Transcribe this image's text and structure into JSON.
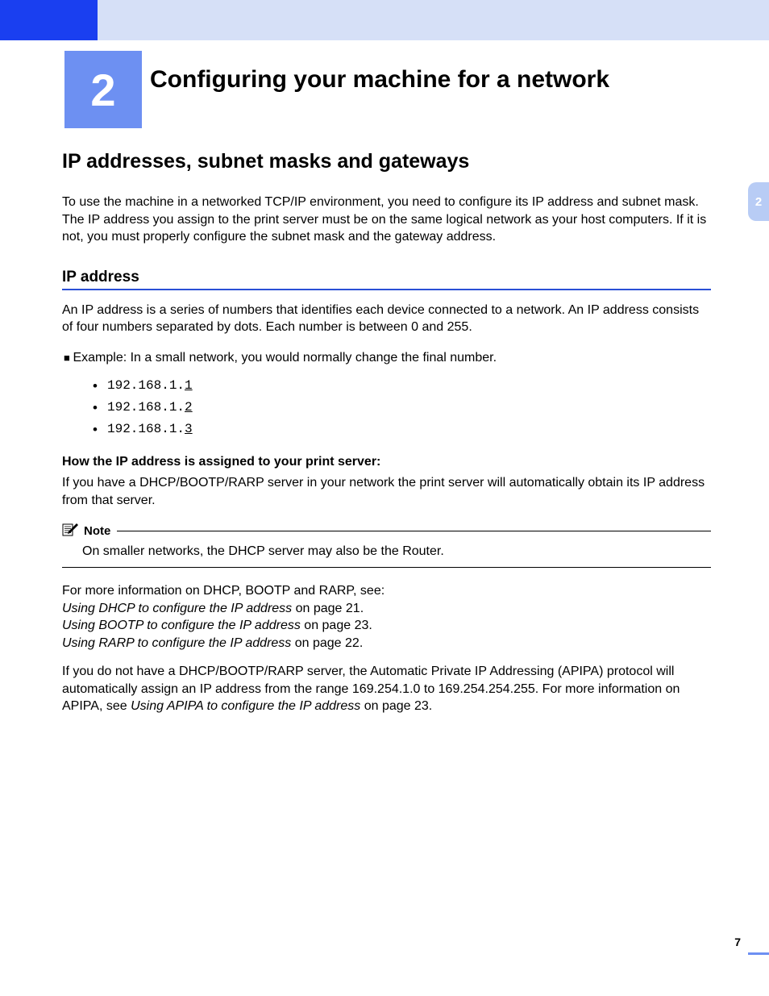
{
  "chapter": {
    "number": "2",
    "title": "Configuring your machine for a network"
  },
  "sideTab": "2",
  "section": {
    "h1": "IP addresses, subnet masks and gateways",
    "intro": "To use the machine in a networked TCP/IP environment, you need to configure its IP address and subnet mask. The IP address you assign to the print server must be on the same logical network as your host computers. If it is not, you must properly configure the subnet mask and the gateway address.",
    "h2": "IP address",
    "ipDesc": "An IP address is a series of numbers that identifies each device connected to a network. An IP address consists of four numbers separated by dots. Each number is between 0 and 255.",
    "exampleLine": "Example: In a small network, you would normally change the final number.",
    "ips": [
      {
        "prefix": "192.168.1.",
        "last": "1"
      },
      {
        "prefix": "192.168.1.",
        "last": "2"
      },
      {
        "prefix": "192.168.1.",
        "last": "3"
      }
    ],
    "h3": "How the IP address is assigned to your print server:",
    "dhcpPara": "If you have a DHCP/BOOTP/RARP server in your network the print server will automatically obtain its IP address from that server.",
    "note": {
      "label": "Note",
      "text": "On smaller networks, the DHCP server may also be the Router."
    },
    "refs": {
      "lead": "For more information on DHCP, BOOTP and RARP, see:",
      "items": [
        {
          "title": "Using DHCP to configure the IP address",
          "suffix": " on page 21."
        },
        {
          "title": "Using BOOTP to configure the IP address",
          "suffix": " on page 23."
        },
        {
          "title": "Using RARP to configure the IP address",
          "suffix": " on page 22."
        }
      ]
    },
    "apipa": {
      "pre": "If you do not have a DHCP/BOOTP/RARP server, the Automatic Private IP Addressing (APIPA) protocol will automatically assign an IP address from the range 169.254.1.0 to 169.254.254.255. For more information on APIPA, see ",
      "link": "Using APIPA to configure the IP address",
      "post": " on page 23."
    }
  },
  "pageNumber": "7"
}
